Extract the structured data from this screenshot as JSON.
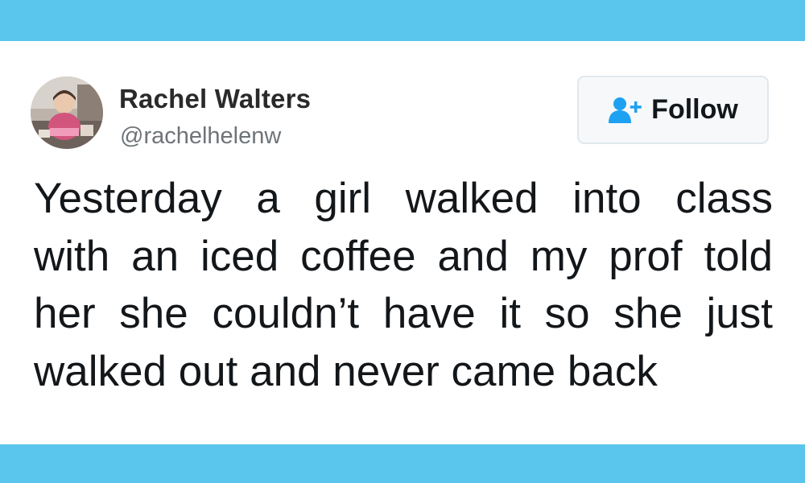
{
  "colors": {
    "band": "#5bc6ed",
    "text": "#14171a",
    "handle": "#6e7479",
    "follow_icon": "#1da1f2"
  },
  "tweet": {
    "display_name": "Rachel Walters",
    "handle": "@rachelhelenw",
    "avatar_icon": "profile-photo",
    "follow_button": {
      "label": "Follow",
      "icon": "add-user-icon"
    },
    "text_lines": [
      "Yesterday a girl walked into class",
      "with an iced coffee and my prof told",
      "her she couldn’t have it so she just",
      "walked out and never came back"
    ]
  }
}
